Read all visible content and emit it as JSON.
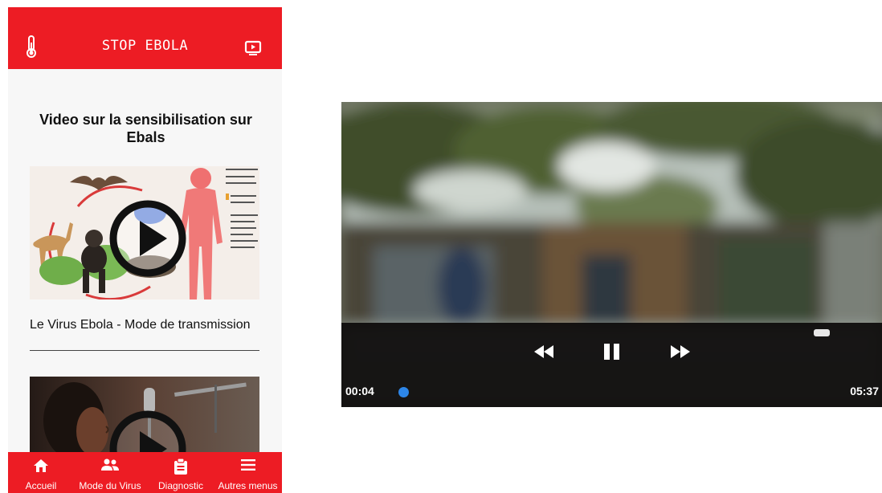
{
  "app": {
    "title": "STOP EBOLA",
    "brand_color": "#ed1c24"
  },
  "topbar": {
    "left_icon": "thermometer-icon",
    "right_icon": "tv-play-icon"
  },
  "feed": {
    "heading": "Video sur la sensibilisation sur Ebals",
    "videos": [
      {
        "title": "Le Virus Ebola - Mode de transmission",
        "thumbnail": "ebola transmission diagram"
      },
      {
        "title": "",
        "thumbnail": "singer at microphone"
      }
    ]
  },
  "bottom_nav": [
    {
      "label": "Accueil",
      "icon": "home-icon"
    },
    {
      "label": "Mode du Virus",
      "icon": "people-icon"
    },
    {
      "label": "Diagnostic",
      "icon": "clipboard-icon"
    },
    {
      "label": "Autres menus",
      "icon": "menu-icon"
    }
  ],
  "player": {
    "current_time": "00:04",
    "total_time": "05:37",
    "progress": 0.012,
    "state": "playing",
    "controls": [
      "rewind-icon",
      "pause-icon",
      "fast-forward-icon"
    ],
    "seek_color": "#2d86e8"
  }
}
